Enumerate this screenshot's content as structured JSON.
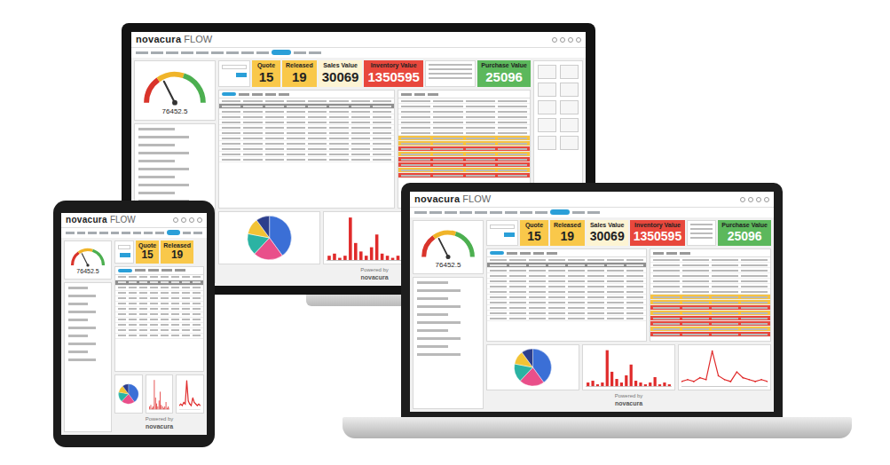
{
  "brand": {
    "name": "novacura",
    "product": "FLOW"
  },
  "gauge": {
    "value": "76452.5",
    "level": 0.35
  },
  "kpis": [
    {
      "label": "Quote",
      "value": "15",
      "color": "#f9c84a"
    },
    {
      "label": "Released",
      "value": "19",
      "color": "#f9c84a"
    },
    {
      "label": "Sales Value",
      "value": "30069",
      "color": "#fdf4d3"
    },
    {
      "label": "Inventory Value",
      "value": "1350595",
      "color": "#e8473c"
    },
    {
      "label": "Purchase Value",
      "value": "25096",
      "color": "#5cb85c"
    }
  ],
  "order_rows": [
    {
      "selected": false
    },
    {
      "selected": true
    },
    {
      "selected": false
    },
    {
      "selected": false
    },
    {
      "selected": false
    },
    {
      "selected": false
    },
    {
      "selected": false
    },
    {
      "selected": false
    },
    {
      "selected": false
    },
    {
      "selected": false
    },
    {
      "selected": false
    },
    {
      "selected": false
    }
  ],
  "stock_rows": [
    {
      "color": "#ffffff"
    },
    {
      "color": "#ffffff"
    },
    {
      "color": "#ffffff"
    },
    {
      "color": "#ffffff"
    },
    {
      "color": "#ffffff"
    },
    {
      "color": "#ffffff"
    },
    {
      "color": "#ffffff"
    },
    {
      "color": "#f6c342"
    },
    {
      "color": "#f6c342"
    },
    {
      "color": "#e8473c"
    },
    {
      "color": "#f6c342"
    },
    {
      "color": "#e8473c"
    },
    {
      "color": "#e8473c"
    },
    {
      "color": "#f6c342"
    },
    {
      "color": "#e8473c"
    }
  ],
  "pie": {
    "slices": [
      {
        "value": 40,
        "color": "#3b6fd6"
      },
      {
        "value": 22,
        "color": "#e94f8a"
      },
      {
        "value": 16,
        "color": "#2bb3a3"
      },
      {
        "value": 12,
        "color": "#f2c335"
      },
      {
        "value": 10,
        "color": "#2c3e8c"
      }
    ]
  },
  "bars": {
    "values": [
      2,
      3,
      1,
      2,
      20,
      8,
      4,
      2,
      6,
      12,
      3,
      2,
      1,
      2,
      5,
      1,
      2,
      1
    ]
  },
  "line": {
    "values": [
      2,
      3,
      2,
      4,
      3,
      18,
      5,
      3,
      2,
      7,
      4,
      3,
      2,
      3,
      2
    ]
  },
  "footer": {
    "caption": "Powered by"
  }
}
